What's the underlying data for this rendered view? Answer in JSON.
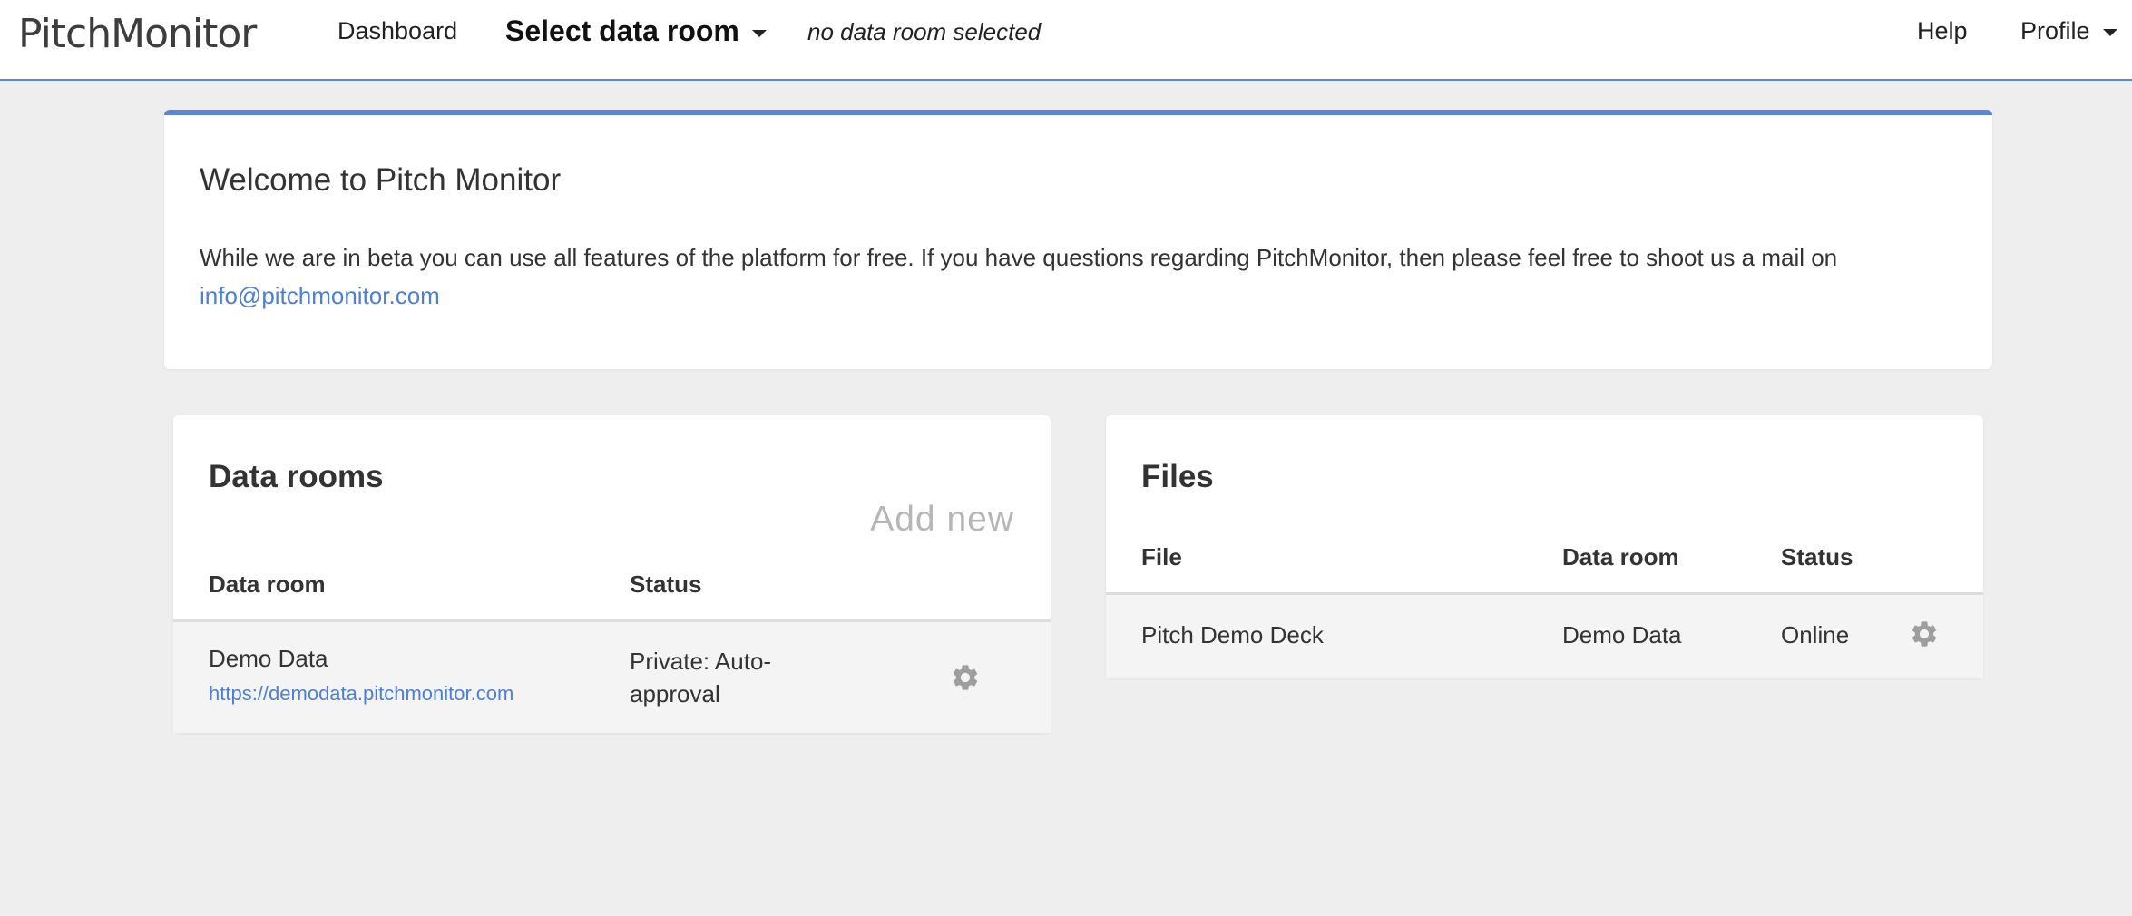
{
  "nav": {
    "logo": "PitchMonitor",
    "dashboard": "Dashboard",
    "select_data_room": "Select data room",
    "no_room": "no data room selected",
    "help": "Help",
    "profile": "Profile"
  },
  "welcome": {
    "title": "Welcome to Pitch Monitor",
    "text": "While we are in beta you can use all features of the platform for free. If you have questions regarding PitchMonitor, then please feel free to shoot us a mail on",
    "email": "info@pitchmonitor.com"
  },
  "data_rooms": {
    "title": "Data rooms",
    "add_new": "Add new",
    "headers": {
      "room": "Data room",
      "status": "Status"
    },
    "rows": [
      {
        "name": "Demo Data",
        "url": "https://demodata.pitchmonitor.com",
        "status_line1": "Private: Auto-",
        "status_line2": "approval"
      }
    ]
  },
  "files": {
    "title": "Files",
    "headers": {
      "file": "File",
      "room": "Data room",
      "status": "Status"
    },
    "rows": [
      {
        "file": "Pitch Demo Deck",
        "room": "Demo Data",
        "status": "Online"
      }
    ]
  },
  "colors": {
    "accent": "#5b86d8",
    "link": "#4d7fd6",
    "background": "#eeeeee"
  }
}
